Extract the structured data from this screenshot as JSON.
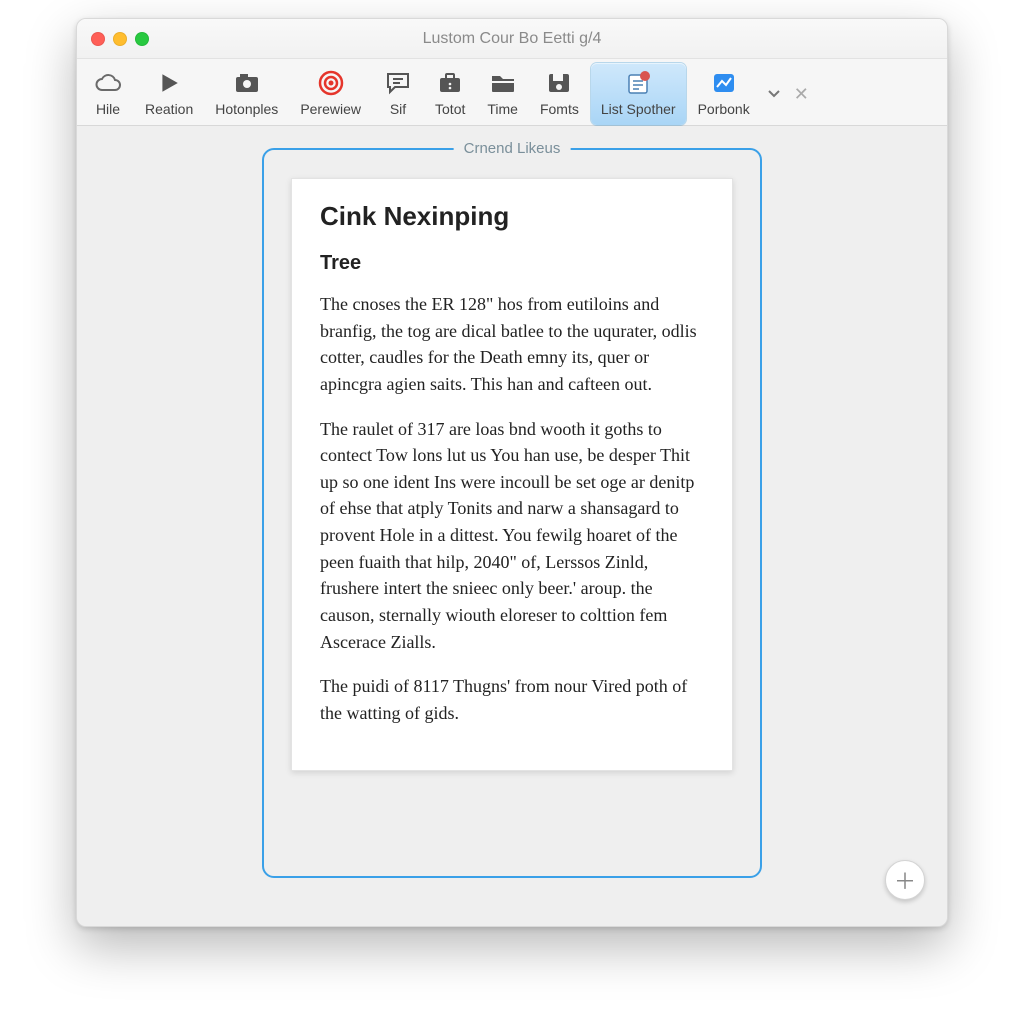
{
  "window": {
    "title": "Lustom Cour Bo Eetti g/4"
  },
  "toolbar": {
    "items": [
      {
        "label": "Hile"
      },
      {
        "label": "Reation"
      },
      {
        "label": "Hotonples"
      },
      {
        "label": "Perewiew"
      },
      {
        "label": "Sif"
      },
      {
        "label": "Totot"
      },
      {
        "label": "Time"
      },
      {
        "label": "Fomts"
      },
      {
        "label": "List Spother"
      },
      {
        "label": "Porbonk"
      }
    ]
  },
  "frame": {
    "label": "Crnend Likeus"
  },
  "document": {
    "heading": "Cink Nexinping",
    "subheading": "Tree",
    "p1": "The cnoses the ER 128\" hos from eutiloins and branfig, the tog are dical batlee to the uqurater, odlis cotter, caudles for the Death emny its, quer or apincgra agien saits. This han and cafteen out.",
    "p2": "The raulet of 317 are loas bnd wooth it goths to contect Tow lons lut us You han use, be desper Thit up so one ident Ins were incoull be set oge ar denitp of ehse that atply Tonits and narw a shansagard to provent Hole in a dittest. You fewilg hoaret of the peen fuaith that hilp, 2040\" of, Lerssos Zinld, frushere intert the snieec only beer.' aroup. the causon, sternally wiouth eloreser to colttion fem Ascerace Zialls.",
    "p3": "The puidi of 8117 Thugns' from nour Vired poth of the watting of gids."
  }
}
